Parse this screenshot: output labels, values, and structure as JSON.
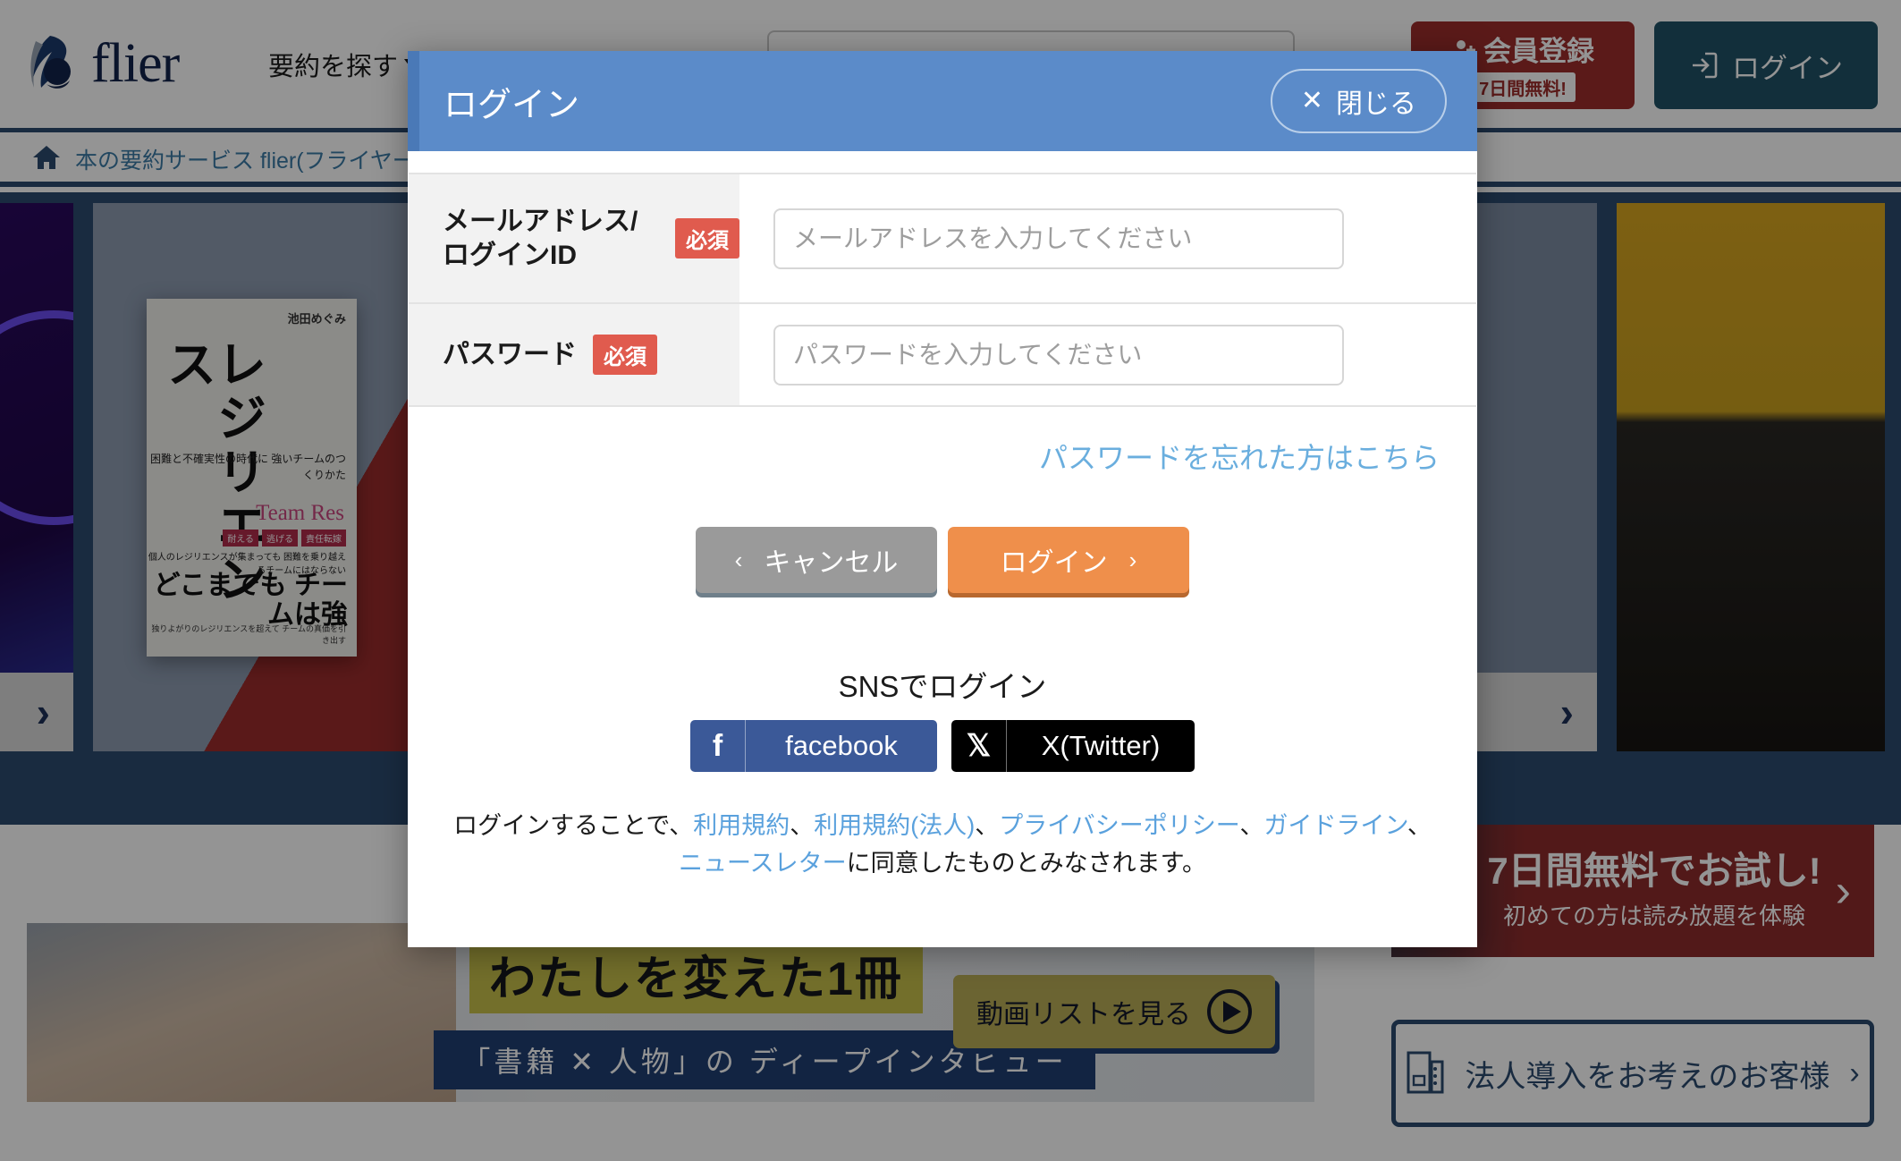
{
  "header": {
    "brand": "flier",
    "nav_browse": "要約を探す",
    "search_placeholder": "",
    "register_label": "会員登録",
    "register_badge": "7日間無料!",
    "login_label": "ログイン"
  },
  "breadcrumb": {
    "home_label": "本の要約サービス flier(フライヤー)"
  },
  "hero": {
    "book": {
      "author": "池田めぐみ",
      "title": "レジリエンス",
      "sub1": "困難と不確実性の時代に\n強いチームのつくりかた",
      "team": "Team Res",
      "tags": [
        "耐える",
        "逃げる",
        "責任転嫁"
      ],
      "sub2": "個人のレジリエンスが集まっても\n困難を乗り越えるチームにはならない",
      "big": "どこまでも\nチームは強",
      "foot": "独りよがりのレジリエンスを超えて\nチームの真価を引き出す"
    },
    "next_label": "›"
  },
  "promo": {
    "headline": "わたしを変えた1冊",
    "subline": "「書籍 ✕ 人物」の ディープインタビュー",
    "video_button": "動画リストを見る"
  },
  "trial": {
    "title": "7日間無料でお試し!",
    "subtitle": "初めての方は読み放題を体験",
    "chevron": "›"
  },
  "corporate": {
    "label": "法人導入をお考えのお客様",
    "chevron": "›"
  },
  "modal": {
    "title": "ログイン",
    "close_label": "閉じる",
    "close_x": "✕",
    "fields": [
      {
        "label": "メールアドレス/\nログインID",
        "required_badge": "必須",
        "placeholder": "メールアドレスを入力してください",
        "value": ""
      },
      {
        "label": "パスワード",
        "required_badge": "必須",
        "placeholder": "パスワードを入力してください",
        "value": ""
      }
    ],
    "forgot_password": "パスワードを忘れた方はこちら",
    "cancel_label": "キャンセル",
    "cancel_chevron": "‹",
    "submit_label": "ログイン",
    "submit_chevron": "›",
    "sns_title": "SNSでログイン",
    "sns_buttons": [
      {
        "glyph": "f",
        "label": "facebook",
        "color": "#3b5998"
      },
      {
        "glyph": "𝕏",
        "label": "X(Twitter)",
        "color": "#000000"
      }
    ],
    "terms": {
      "lead": "ログインすることで、",
      "link1": "利用規約",
      "sep1": "、",
      "link2": "利用規約(法人)",
      "sep2": "、",
      "link3": "プライバシーポリシー",
      "sep3": "、",
      "link4": "ガイドライン",
      "sep4": "、",
      "link5": "ニュースレター",
      "tail": "に同意したものとみなされます。"
    }
  },
  "colors": {
    "modal_header": "#5b8bc9",
    "submit": "#ef8f4b",
    "required": "#e05b4e",
    "brand_navy": "#2b4a6f",
    "link": "#5aa1dd"
  }
}
